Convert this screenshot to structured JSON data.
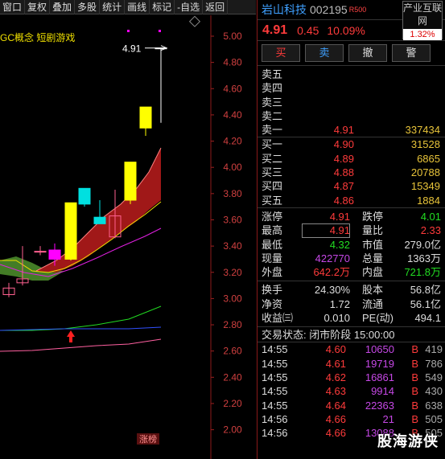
{
  "toolbar": [
    "窗口",
    "复权",
    "叠加",
    "多股",
    "统计",
    "画线",
    "标记",
    "-自选",
    "返回"
  ],
  "chart": {
    "concept_label": "GC概念 短剧游戏",
    "price_tag": "4.91",
    "zt_label": "涨榜",
    "y_ticks": [
      "5.00",
      "4.80",
      "4.60",
      "4.40",
      "4.20",
      "4.00",
      "3.80",
      "3.60",
      "3.40",
      "3.20",
      "3.00",
      "2.80",
      "2.60",
      "2.40",
      "2.20",
      "2.00"
    ],
    "colors": {
      "up": "#ffff00",
      "down": "#00e0e0",
      "pink": "#ff00ff",
      "ma_white": "#ffffff",
      "ma_yellow": "#f0e000",
      "ma_magenta": "#e020e0",
      "ma_green": "#22dd22",
      "ma_blue": "#3050ff",
      "ma_pink": "#ff60a0",
      "fill_red": "#a01818",
      "fill_green": "#4a8a2a"
    }
  },
  "chart_data": {
    "type": "candlestick",
    "candles": [
      {
        "o": 3.08,
        "h": 3.12,
        "l": 3.01,
        "c": 3.03,
        "color": "pink"
      },
      {
        "o": 3.12,
        "h": 3.4,
        "l": 3.1,
        "c": 3.15,
        "color": "pink"
      },
      {
        "o": 3.36,
        "h": 3.4,
        "l": 3.33,
        "c": 3.36,
        "color": "pink"
      },
      {
        "o": 3.3,
        "h": 3.42,
        "l": 3.25,
        "c": 3.37,
        "color": "magenta"
      },
      {
        "o": 3.3,
        "h": 3.73,
        "l": 3.29,
        "c": 3.73,
        "color": "yellow"
      },
      {
        "o": 3.84,
        "h": 3.84,
        "l": 3.7,
        "c": 3.72,
        "color": "cyan"
      },
      {
        "o": 3.62,
        "h": 3.75,
        "l": 3.57,
        "c": 3.57,
        "color": "cyan"
      },
      {
        "o": 3.47,
        "h": 3.83,
        "l": 3.46,
        "c": 3.63,
        "color": "pink"
      },
      {
        "o": 3.75,
        "h": 4.04,
        "l": 3.72,
        "c": 4.04,
        "color": "yellow"
      },
      {
        "o": 4.3,
        "h": 4.46,
        "l": 4.24,
        "c": 4.46,
        "color": "yellow"
      },
      {
        "o": 4.91,
        "h": 4.91,
        "l": 4.34,
        "c": 4.91,
        "color": "white"
      }
    ],
    "ylim": [
      2.0,
      5.1
    ]
  },
  "stock": {
    "name": "岩山科技",
    "code": "002195",
    "badge": "R500",
    "price": "4.91",
    "change": "0.45",
    "change_pct": "10.09%"
  },
  "industry": {
    "name": "产业互联网",
    "pct": "1.32%"
  },
  "actions": [
    "买",
    "卖",
    "撤",
    "警"
  ],
  "asks": [
    {
      "label": "卖五",
      "price": "",
      "vol": ""
    },
    {
      "label": "卖四",
      "price": "",
      "vol": ""
    },
    {
      "label": "卖三",
      "price": "",
      "vol": ""
    },
    {
      "label": "卖二",
      "price": "",
      "vol": ""
    },
    {
      "label": "卖一",
      "price": "4.91",
      "vol": "337434"
    }
  ],
  "bids": [
    {
      "label": "买一",
      "price": "4.90",
      "vol": "31528"
    },
    {
      "label": "买二",
      "price": "4.89",
      "vol": "6865"
    },
    {
      "label": "买三",
      "price": "4.88",
      "vol": "20788"
    },
    {
      "label": "买四",
      "price": "4.87",
      "vol": "15349"
    },
    {
      "label": "买五",
      "price": "4.86",
      "vol": "1884"
    }
  ],
  "stats": [
    {
      "l1": "涨停",
      "v1": "4.91",
      "c1": "#ff3b3b",
      "l2": "跌停",
      "v2": "4.01",
      "c2": "#22dd22"
    },
    {
      "l1": "最高",
      "v1": "4.91",
      "c1": "#ff3b3b",
      "boxed": true,
      "l2": "量比",
      "v2": "2.33",
      "c2": "#ff3b3b"
    },
    {
      "l1": "最低",
      "v1": "4.32",
      "c1": "#22dd22",
      "l2": "市值",
      "v2": "279.0亿",
      "c2": "#ddd"
    },
    {
      "l1": "现量",
      "v1": "422770",
      "c1": "#c648e6",
      "l2": "总量",
      "v2": "1363万",
      "c2": "#ddd"
    },
    {
      "l1": "外盘",
      "v1": "642.2万",
      "c1": "#ff3b3b",
      "l2": "内盘",
      "v2": "721.8万",
      "c2": "#22dd22"
    }
  ],
  "stats2": [
    {
      "l1": "换手",
      "v1": "24.30%",
      "c1": "#ddd",
      "l2": "股本",
      "v2": "56.8亿",
      "c2": "#ddd"
    },
    {
      "l1": "净资",
      "v1": "1.72",
      "c1": "#ddd",
      "l2": "流通",
      "v2": "56.1亿",
      "c2": "#ddd"
    },
    {
      "l1": "收益㈢",
      "v1": "0.010",
      "c1": "#ddd",
      "l2": "PE(动)",
      "v2": "494.1",
      "c2": "#ddd"
    }
  ],
  "trade_state": "交易状态: 闭市阶段 15:00:00",
  "trades": [
    {
      "t": "14:55",
      "p": "4.60",
      "v": "10650",
      "d": "B",
      "c": "419"
    },
    {
      "t": "14:55",
      "p": "4.61",
      "v": "19719",
      "d": "B",
      "c": "786"
    },
    {
      "t": "14:55",
      "p": "4.62",
      "v": "16861",
      "d": "B",
      "c": "549"
    },
    {
      "t": "14:55",
      "p": "4.63",
      "v": "9914",
      "d": "B",
      "c": "430"
    },
    {
      "t": "14:55",
      "p": "4.64",
      "v": "22363",
      "d": "B",
      "c": "638"
    },
    {
      "t": "14:56",
      "p": "4.66",
      "v": "21",
      "d": "B",
      "c": "505"
    },
    {
      "t": "14:56",
      "p": "4.66",
      "v": "13088",
      "d": "B",
      "c": "505"
    }
  ],
  "watermark": "股海游侠"
}
